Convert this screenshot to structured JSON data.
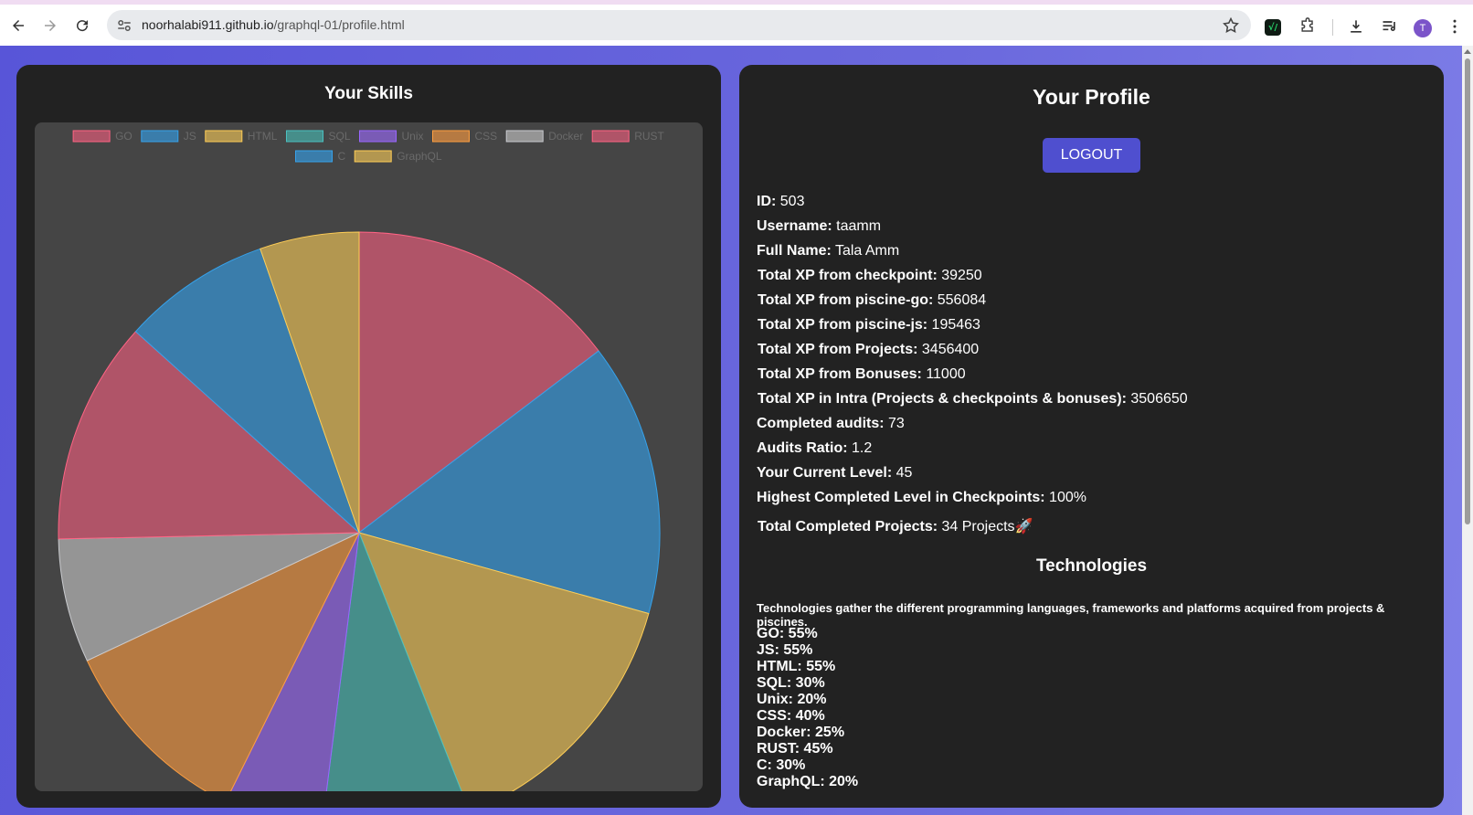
{
  "browser": {
    "url_host": "noorhalabi911.github.io",
    "url_path": "/graphql-01/profile.html",
    "avatar_letter": "T",
    "extension_label": "√/"
  },
  "skills": {
    "title": "Your Skills"
  },
  "chart_data": {
    "type": "pie",
    "categories": [
      "GO",
      "JS",
      "HTML",
      "SQL",
      "Unix",
      "CSS",
      "Docker",
      "RUST",
      "C",
      "GraphQL"
    ],
    "values": [
      55,
      55,
      55,
      30,
      20,
      40,
      25,
      45,
      30,
      20
    ],
    "colors": [
      "#b05468",
      "#3a7dab",
      "#b39750",
      "#468e8a",
      "#7a5bb6",
      "#b67a42",
      "#959595",
      "#b05468",
      "#3a7dab",
      "#b39750"
    ],
    "border_colors": [
      "#ff6384",
      "#36a2eb",
      "#ffce56",
      "#4bc0c0",
      "#9966ff",
      "#ff9f40",
      "#c9cbcf",
      "#ff6384",
      "#36a2eb",
      "#ffce56"
    ],
    "legend_position": "top",
    "start_angle_deg": 0
  },
  "profile": {
    "title": "Your Profile",
    "logout_label": "LOGOUT",
    "fields": [
      {
        "label": "ID:",
        "value": " 503"
      },
      {
        "label": "Username:",
        "value": " taamm"
      },
      {
        "label": "Full Name:",
        "value": " Tala Amm"
      },
      {
        "label": "Total XP from checkpoint:",
        "value": " 39250"
      },
      {
        "label": "Total XP from piscine-go:",
        "value": " 556084"
      },
      {
        "label": "Total XP from piscine-js:",
        "value": " 195463"
      },
      {
        "label": "Total XP from Projects:",
        "value": " 3456400"
      },
      {
        "label": "Total XP from Bonuses:",
        "value": " 11000"
      },
      {
        "label": "Total XP in Intra (Projects & checkpoints & bonuses):",
        "value": " 3506650"
      },
      {
        "label": "Completed audits:",
        "value": " 73"
      },
      {
        "label": "Audits Ratio:",
        "value": " 1.2"
      },
      {
        "label": "Your Current Level:",
        "value": " 45"
      },
      {
        "label": "Highest Completed Level in Checkpoints:",
        "value": " 100%"
      },
      {
        "label": "Total Completed Projects:",
        "value": " 34 Projects🚀"
      }
    ]
  },
  "technologies": {
    "title": "Technologies",
    "description": "Technologies gather the different programming languages, frameworks and platforms acquired from projects & piscines.",
    "items": [
      "GO: 55%",
      "JS: 55%",
      "HTML: 55%",
      "SQL: 30%",
      "Unix: 20%",
      "CSS: 40%",
      "Docker: 25%",
      "RUST: 45%",
      "C: 30%",
      "GraphQL: 20%"
    ]
  }
}
